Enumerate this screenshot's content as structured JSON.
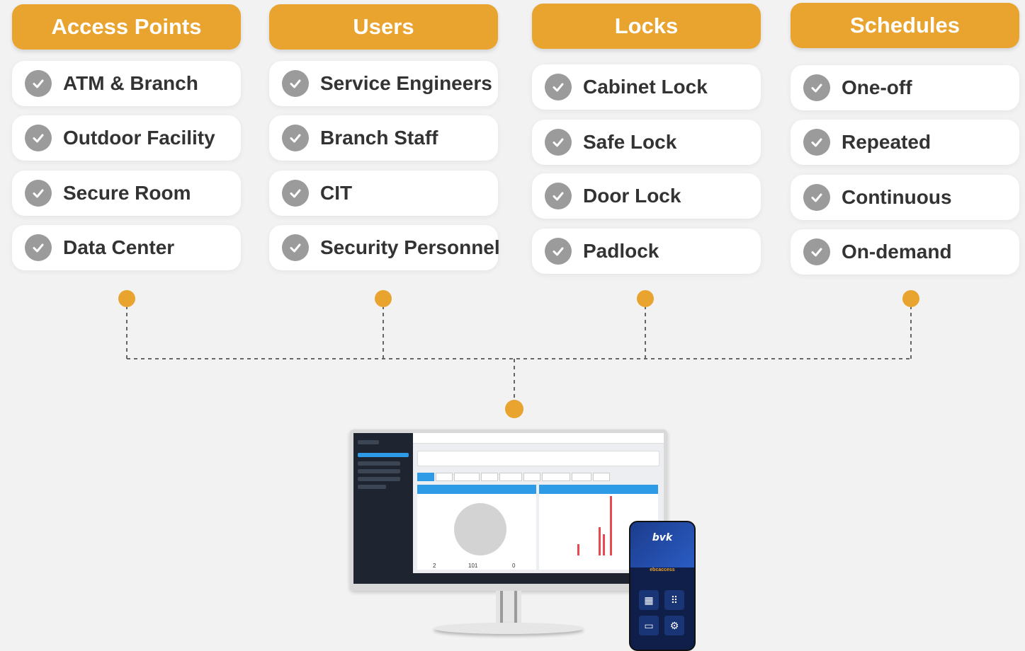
{
  "columns": [
    {
      "title": "Access Points",
      "items": [
        "ATM & Branch",
        "Outdoor Facility",
        "Secure Room",
        "Data Center"
      ]
    },
    {
      "title": "Users",
      "items": [
        "Service Engineers",
        "Branch Staff",
        "CIT",
        "Security Personnel"
      ]
    },
    {
      "title": "Locks",
      "items": [
        "Cabinet Lock",
        "Safe Lock",
        "Door Lock",
        "Padlock"
      ]
    },
    {
      "title": "Schedules",
      "items": [
        "One-off",
        "Repeated",
        "Continuous",
        "On-demand"
      ]
    }
  ],
  "colors": {
    "accent": "#e8a42e",
    "check": "#9b9b9b",
    "background": "#f2f2f2"
  },
  "icons": {
    "item": "check-circle-icon"
  },
  "mockup": {
    "stats": [
      "2",
      "101",
      "0"
    ],
    "phone_brand": "bvk",
    "phone_app": "ebcaccess"
  }
}
